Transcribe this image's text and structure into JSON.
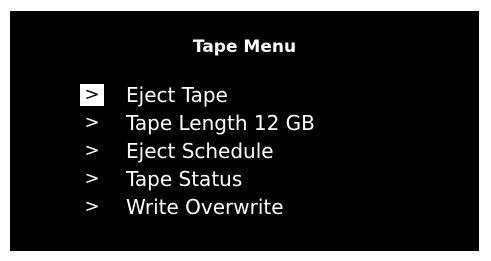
{
  "menu": {
    "title": "Tape Menu",
    "cursor_glyph": ">",
    "selected_index": 0,
    "items": [
      {
        "label": "Eject Tape"
      },
      {
        "label": "Tape Length 12 GB"
      },
      {
        "label": "Eject Schedule"
      },
      {
        "label": "Tape Status"
      },
      {
        "label": "Write Overwrite"
      }
    ]
  },
  "colors": {
    "background": "#000000",
    "text": "#ffffff",
    "highlight": "#ffffff"
  }
}
